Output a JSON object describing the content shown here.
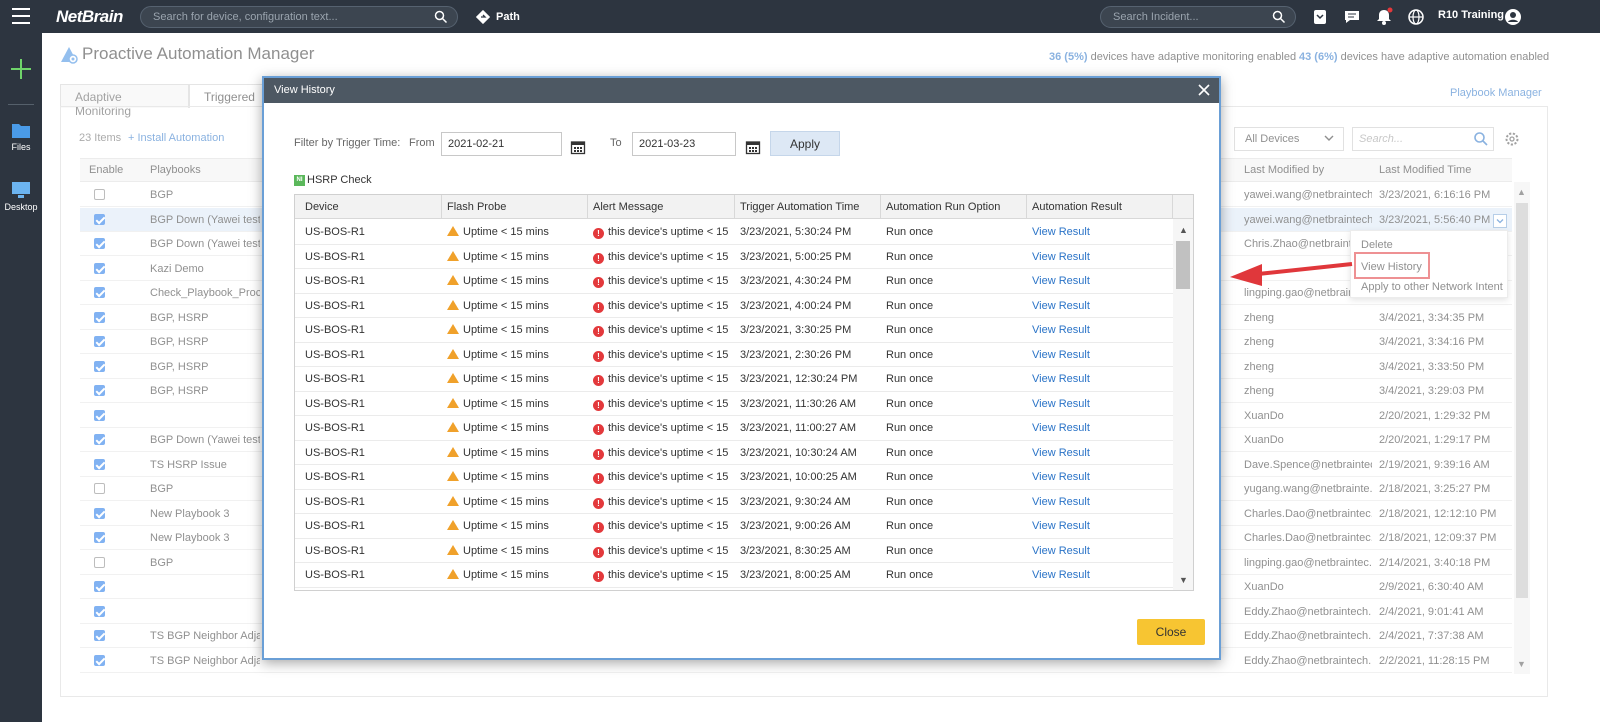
{
  "topbar": {
    "logo": "NetBrain",
    "search_placeholder": "Search for device, configuration text...",
    "path_label": "Path",
    "incident_placeholder": "Search Incident...",
    "user": "R10 Training"
  },
  "leftnav": {
    "files": "Files",
    "desktop": "Desktop"
  },
  "page": {
    "title": "Proactive Automation Manager",
    "stat1_count": "36 (5%)",
    "stat1_text": "devices have adaptive monitoring enabled",
    "stat2_count": "43 (6%)",
    "stat2_text": "devices have adaptive automation enabled",
    "tab1": "Adaptive Monitoring",
    "tab2": "Triggered",
    "playbook_manager": "Playbook Manager",
    "items": "23 Items",
    "install": "+ Install Automation",
    "device_filter": "All Devices",
    "search_placeholder": "Search..."
  },
  "bg_table": {
    "headers": {
      "enable": "Enable",
      "playbooks": "Playbooks",
      "modified_by": "Last Modified by",
      "modified_time": "Last Modified Time"
    },
    "rows": [
      {
        "checked": false,
        "playbook": "BGP",
        "by": "yawei.wang@netbraintech....",
        "time": "3/23/2021, 6:16:16 PM"
      },
      {
        "checked": true,
        "playbook": "BGP Down (Yawei test), (",
        "by": "yawei.wang@netbraintech....",
        "time": "3/23/2021, 5:56:40 PM",
        "selected": true
      },
      {
        "checked": true,
        "playbook": "BGP Down (Yawei test)",
        "by": "Chris.Zhao@netbraintech...",
        "time": ""
      },
      {
        "checked": true,
        "playbook": "Kazi Demo",
        "by": "",
        "time": ""
      },
      {
        "checked": true,
        "playbook": "Check_Playbook_Process",
        "by": "lingping.gao@netbraintech...",
        "time": ""
      },
      {
        "checked": true,
        "playbook": "BGP, HSRP",
        "by": "zheng",
        "time": "3/4/2021, 3:34:35 PM"
      },
      {
        "checked": true,
        "playbook": "BGP, HSRP",
        "by": "zheng",
        "time": "3/4/2021, 3:34:16 PM"
      },
      {
        "checked": true,
        "playbook": "BGP, HSRP",
        "by": "zheng",
        "time": "3/4/2021, 3:33:50 PM"
      },
      {
        "checked": true,
        "playbook": "BGP, HSRP",
        "by": "zheng",
        "time": "3/4/2021, 3:29:03 PM"
      },
      {
        "checked": true,
        "playbook": "",
        "by": "XuanDo",
        "time": "2/20/2021, 1:29:32 PM"
      },
      {
        "checked": true,
        "playbook": "BGP Down (Yawei test)",
        "by": "XuanDo",
        "time": "2/20/2021, 1:29:17 PM"
      },
      {
        "checked": true,
        "playbook": "TS HSRP Issue",
        "by": "Dave.Spence@netbraintec...",
        "time": "2/19/2021, 9:39:16 AM"
      },
      {
        "checked": false,
        "playbook": "BGP",
        "by": "yugang.wang@netbrainte...",
        "time": "2/18/2021, 3:25:27 PM"
      },
      {
        "checked": true,
        "playbook": "New Playbook 3",
        "by": "Charles.Dao@netbraintec...",
        "time": "2/18/2021, 12:12:10 PM"
      },
      {
        "checked": true,
        "playbook": "New Playbook 3",
        "by": "Charles.Dao@netbraintec...",
        "time": "2/18/2021, 12:09:37 PM"
      },
      {
        "checked": false,
        "playbook": "BGP",
        "by": "lingping.gao@netbraintec...",
        "time": "2/14/2021, 3:40:18 PM"
      },
      {
        "checked": true,
        "playbook": "",
        "by": "XuanDo",
        "time": "2/9/2021, 6:30:40 AM"
      },
      {
        "checked": true,
        "playbook": "",
        "by": "Eddy.Zhao@netbraintech....",
        "time": "2/4/2021, 9:01:41 AM"
      },
      {
        "checked": true,
        "playbook": "TS BGP Neighbor Adjace",
        "by": "Eddy.Zhao@netbraintech....",
        "time": "2/4/2021, 7:37:38 AM"
      },
      {
        "checked": true,
        "playbook": "TS BGP Neighbor Adjacen...",
        "by": "Eddy.Zhao@netbraintech....",
        "time": "2/2/2021, 11:28:15 PM"
      }
    ]
  },
  "context_menu": {
    "delete": "Delete",
    "view_history": "View History",
    "apply": "Apply to other Network Intent"
  },
  "dialog": {
    "title": "View History",
    "filter_label": "Filter by Trigger Time:",
    "from_label": "From",
    "from_value": "2021-02-21",
    "to_label": "To",
    "to_value": "2021-03-23",
    "apply": "Apply",
    "ni_badge": "NI",
    "ni_name": "HSRP Check",
    "headers": {
      "device": "Device",
      "probe": "Flash Probe",
      "alert": "Alert Message",
      "trigger": "Trigger Automation Time",
      "option": "Automation Run Option",
      "result": "Automation Result"
    },
    "rows": [
      {
        "device": "US-BOS-R1",
        "probe": "Uptime < 15 mins",
        "alert": "this device's uptime < 15 ...",
        "trigger": "3/23/2021, 5:30:24 PM",
        "option": "Run once",
        "result": "View Result"
      },
      {
        "device": "US-BOS-R1",
        "probe": "Uptime < 15 mins",
        "alert": "this device's uptime < 15 ...",
        "trigger": "3/23/2021, 5:00:25 PM",
        "option": "Run once",
        "result": "View Result"
      },
      {
        "device": "US-BOS-R1",
        "probe": "Uptime < 15 mins",
        "alert": "this device's uptime < 15 ...",
        "trigger": "3/23/2021, 4:30:24 PM",
        "option": "Run once",
        "result": "View Result"
      },
      {
        "device": "US-BOS-R1",
        "probe": "Uptime < 15 mins",
        "alert": "this device's uptime < 15 ...",
        "trigger": "3/23/2021, 4:00:24 PM",
        "option": "Run once",
        "result": "View Result"
      },
      {
        "device": "US-BOS-R1",
        "probe": "Uptime < 15 mins",
        "alert": "this device's uptime < 15 ...",
        "trigger": "3/23/2021, 3:30:25 PM",
        "option": "Run once",
        "result": "View Result"
      },
      {
        "device": "US-BOS-R1",
        "probe": "Uptime < 15 mins",
        "alert": "this device's uptime < 15 ...",
        "trigger": "3/23/2021, 2:30:26 PM",
        "option": "Run once",
        "result": "View Result"
      },
      {
        "device": "US-BOS-R1",
        "probe": "Uptime < 15 mins",
        "alert": "this device's uptime < 15 ...",
        "trigger": "3/23/2021, 12:30:24 PM",
        "option": "Run once",
        "result": "View Result"
      },
      {
        "device": "US-BOS-R1",
        "probe": "Uptime < 15 mins",
        "alert": "this device's uptime < 15 ...",
        "trigger": "3/23/2021, 11:30:26 AM",
        "option": "Run once",
        "result": "View Result"
      },
      {
        "device": "US-BOS-R1",
        "probe": "Uptime < 15 mins",
        "alert": "this device's uptime < 15 ...",
        "trigger": "3/23/2021, 11:00:27 AM",
        "option": "Run once",
        "result": "View Result"
      },
      {
        "device": "US-BOS-R1",
        "probe": "Uptime < 15 mins",
        "alert": "this device's uptime < 15 ...",
        "trigger": "3/23/2021, 10:30:24 AM",
        "option": "Run once",
        "result": "View Result"
      },
      {
        "device": "US-BOS-R1",
        "probe": "Uptime < 15 mins",
        "alert": "this device's uptime < 15 ...",
        "trigger": "3/23/2021, 10:00:25 AM",
        "option": "Run once",
        "result": "View Result"
      },
      {
        "device": "US-BOS-R1",
        "probe": "Uptime < 15 mins",
        "alert": "this device's uptime < 15 ...",
        "trigger": "3/23/2021, 9:30:24 AM",
        "option": "Run once",
        "result": "View Result"
      },
      {
        "device": "US-BOS-R1",
        "probe": "Uptime < 15 mins",
        "alert": "this device's uptime < 15 ...",
        "trigger": "3/23/2021, 9:00:26 AM",
        "option": "Run once",
        "result": "View Result"
      },
      {
        "device": "US-BOS-R1",
        "probe": "Uptime < 15 mins",
        "alert": "this device's uptime < 15 ...",
        "trigger": "3/23/2021, 8:30:25 AM",
        "option": "Run once",
        "result": "View Result"
      },
      {
        "device": "US-BOS-R1",
        "probe": "Uptime < 15 mins",
        "alert": "this device's uptime < 15 ...",
        "trigger": "3/23/2021, 8:00:25 AM",
        "option": "Run once",
        "result": "View Result"
      }
    ],
    "close": "Close"
  },
  "colors": {
    "accent": "#2a73c7",
    "topbar": "#2d3540",
    "close_button": "#f7c532",
    "highlight": "#e0373b"
  }
}
